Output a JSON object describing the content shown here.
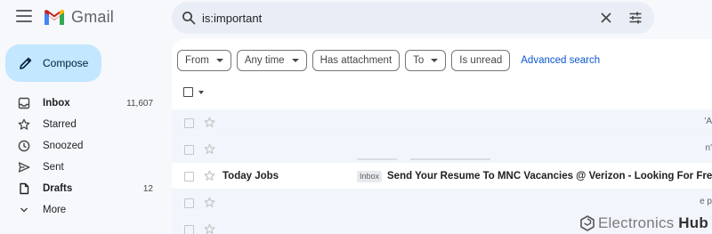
{
  "app": {
    "name": "Gmail"
  },
  "compose": {
    "label": "Compose"
  },
  "sidebar": {
    "items": [
      {
        "label": "Inbox",
        "count": "11,607",
        "icon": "inbox-icon",
        "bold": true
      },
      {
        "label": "Starred",
        "count": "",
        "icon": "star-icon",
        "bold": false
      },
      {
        "label": "Snoozed",
        "count": "",
        "icon": "clock-icon",
        "bold": false
      },
      {
        "label": "Sent",
        "count": "",
        "icon": "send-icon",
        "bold": false
      },
      {
        "label": "Drafts",
        "count": "12",
        "icon": "draft-icon",
        "bold": true
      },
      {
        "label": "More",
        "count": "",
        "icon": "chevron-down-icon",
        "bold": false
      }
    ]
  },
  "search": {
    "value": "is:important"
  },
  "filters": {
    "from": "From",
    "any_time": "Any time",
    "has_attachment": "Has attachment",
    "to": "To",
    "is_unread": "Is unread",
    "advanced": "Advanced search"
  },
  "rows": [
    {
      "sender": "",
      "tag": "",
      "subject": "",
      "fragment": "'A"
    },
    {
      "sender": "",
      "tag": "",
      "subject": "",
      "fragment": "n'"
    },
    {
      "sender": "Today Jobs",
      "tag": "Inbox",
      "subject": "Send Your Resume To MNC Vacancies @ Verizon - Looking For Freshers",
      "fragment": ""
    },
    {
      "sender": "",
      "tag": "",
      "subject": "",
      "fragment": "e p"
    },
    {
      "sender": "",
      "tag": "",
      "subject": "",
      "fragment": ""
    }
  ],
  "watermark": {
    "part1": "Electronics",
    "part2": "Hub"
  },
  "colors": {
    "background": "#f6f8fc",
    "compose": "#c2e7ff",
    "search": "#e9eef6",
    "link": "#0b57d0"
  }
}
